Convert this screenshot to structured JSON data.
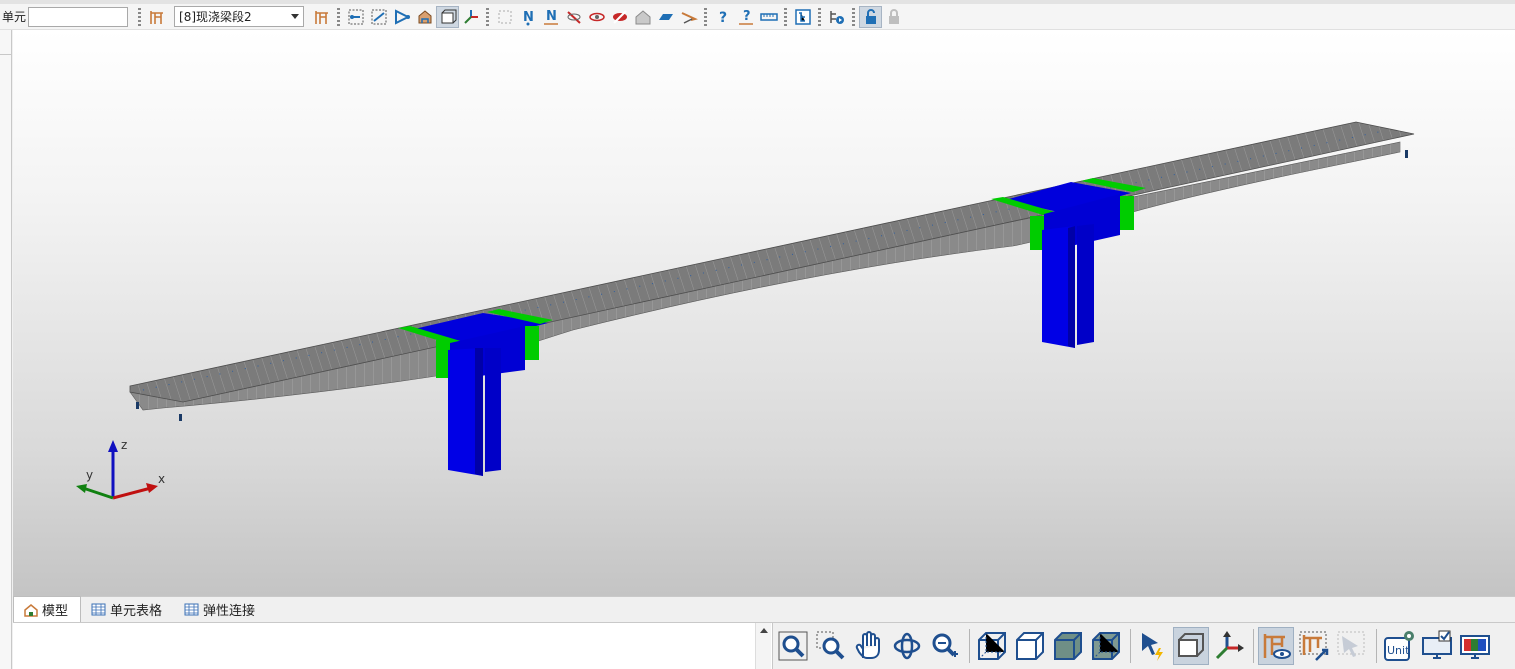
{
  "toolbar": {
    "element_label": "单元",
    "element_input_value": "",
    "group_select_value": "[8]现浇梁段2",
    "buttons": [
      {
        "icon": "frame-icon"
      },
      {
        "icon": "node-select-icon"
      },
      {
        "icon": "element-select-icon"
      },
      {
        "icon": "polyline-select-icon"
      },
      {
        "icon": "model-view-icon"
      },
      {
        "icon": "hidden-view-icon"
      },
      {
        "icon": "axis-icon"
      },
      {
        "icon": "window-select-icon"
      },
      {
        "icon": "node-number-icon"
      },
      {
        "icon": "node-number-alt-icon"
      },
      {
        "icon": "hide-icon"
      },
      {
        "icon": "show-icon"
      },
      {
        "icon": "eye-off-icon"
      },
      {
        "icon": "home-icon"
      },
      {
        "icon": "section-icon"
      },
      {
        "icon": "arrow-icon"
      },
      {
        "icon": "query-node-icon"
      },
      {
        "icon": "query-element-icon"
      },
      {
        "icon": "measure-icon"
      },
      {
        "icon": "tree-icon"
      },
      {
        "icon": "record-icon"
      },
      {
        "icon": "lock-icon"
      },
      {
        "icon": "unlock-icon"
      }
    ]
  },
  "viewport": {
    "axis_labels": {
      "z": "z",
      "y": "y",
      "x": "x"
    },
    "colors": {
      "deck": "#7d7d7d",
      "pier": "#0000e6",
      "segment": "#00c800",
      "axis_z": "#1010c0",
      "axis_y": "#108010",
      "axis_x": "#c01010"
    }
  },
  "tabs": [
    {
      "label": "模型",
      "icon": "home-icon",
      "active": true
    },
    {
      "label": "单元表格",
      "icon": "table-icon",
      "active": false
    },
    {
      "label": "弹性连接",
      "icon": "table-icon",
      "active": false
    }
  ],
  "view_toolbar": {
    "buttons": [
      {
        "icon": "zoom-fit-icon"
      },
      {
        "icon": "zoom-window-icon"
      },
      {
        "icon": "pan-hand-icon"
      },
      {
        "icon": "rotate-icon"
      },
      {
        "icon": "zoom-in-out-icon"
      },
      {
        "icon": "wireframe-view-icon"
      },
      {
        "icon": "hidden-line-view-icon"
      },
      {
        "icon": "shaded-view-icon"
      },
      {
        "icon": "shaded-edges-view-icon"
      },
      {
        "icon": "pointer-select-icon"
      },
      {
        "icon": "display-box-icon"
      },
      {
        "icon": "coordinate-axes-icon"
      },
      {
        "icon": "frame-eye-icon"
      },
      {
        "icon": "frame-pick-icon"
      },
      {
        "icon": "frame-disabled-icon"
      },
      {
        "icon": "unit-settings-icon"
      },
      {
        "icon": "monitor-check-icon"
      },
      {
        "icon": "monitor-color-icon"
      }
    ],
    "unit_text": "Unit"
  }
}
